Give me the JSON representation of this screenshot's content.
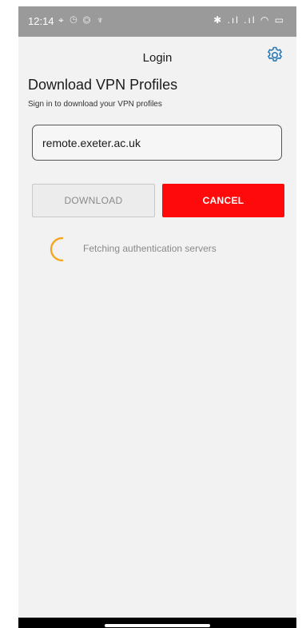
{
  "status_bar": {
    "time": "12:14",
    "left_icons": "⌖ ◷ ◎ ♆",
    "right_icons": "✱ .ıl .ıl ◠ ▭"
  },
  "app_bar": {
    "title": "Login",
    "settings_icon": "gear-icon"
  },
  "main": {
    "heading": "Download VPN Profiles",
    "subheading": "Sign in to download your VPN profiles",
    "server_field": {
      "value": "remote.exeter.ac.uk"
    },
    "download_label": "DOWNLOAD",
    "cancel_label": "CANCEL",
    "status_text": "Fetching authentication servers"
  },
  "colors": {
    "cancel": "#ff0a0a",
    "spinner": "#f5a623",
    "settings_icon": "#2b7bb9",
    "status_bar": "#9a9a9a"
  }
}
